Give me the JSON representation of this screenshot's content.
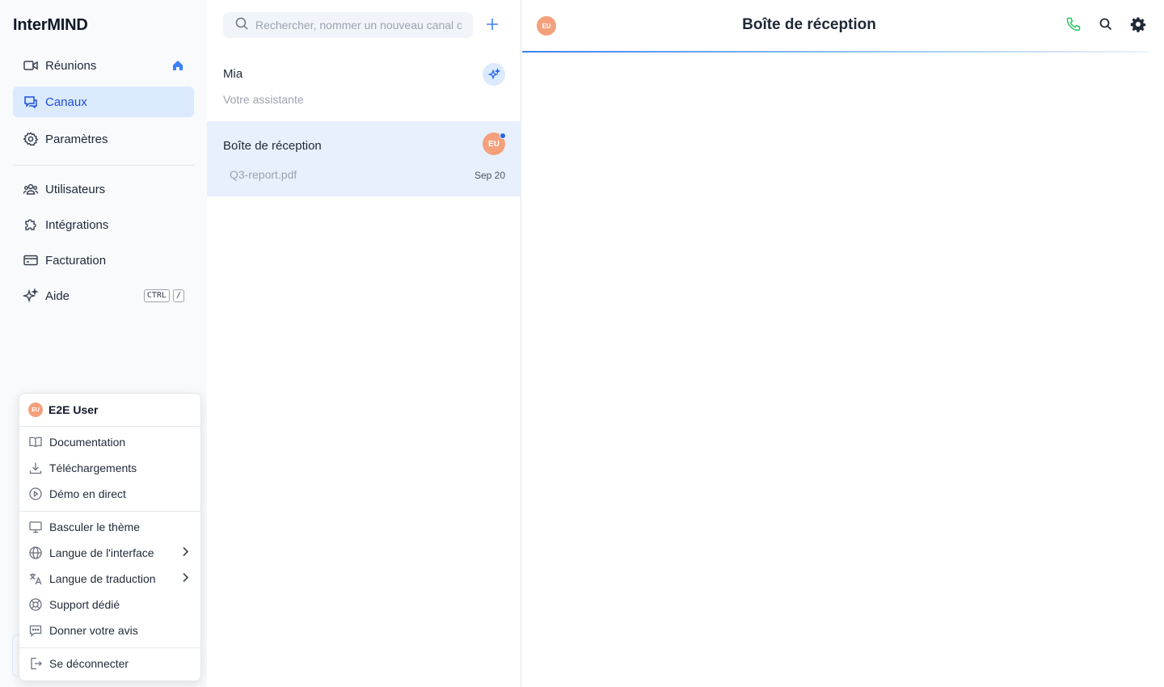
{
  "app": {
    "title": "InterMIND"
  },
  "sidebar": {
    "items": [
      {
        "label": "Réunions",
        "icon": "video-icon"
      },
      {
        "label": "Canaux",
        "icon": "chat-icon",
        "active": true
      },
      {
        "label": "Paramètres",
        "icon": "gear-icon"
      },
      {
        "label": "Utilisateurs",
        "icon": "users-icon"
      },
      {
        "label": "Intégrations",
        "icon": "puzzle-icon"
      },
      {
        "label": "Facturation",
        "icon": "credit-card-icon"
      },
      {
        "label": "Aide",
        "icon": "sparkles-icon",
        "shortcut": [
          "CTRL",
          "/"
        ]
      }
    ]
  },
  "user_menu": {
    "avatar": "EU",
    "name": "E2E User",
    "items": [
      {
        "label": "Documentation",
        "icon": "book-icon"
      },
      {
        "label": "Téléchargements",
        "icon": "download-icon"
      },
      {
        "label": "Démo en direct",
        "icon": "play-circle-icon"
      },
      {
        "label": "Basculer le thème",
        "icon": "monitor-icon"
      },
      {
        "label": "Langue de l'interface",
        "icon": "globe-icon",
        "submenu": true
      },
      {
        "label": "Langue de traduction",
        "icon": "translate-icon",
        "submenu": true
      },
      {
        "label": "Support dédié",
        "icon": "lifebuoy-icon"
      },
      {
        "label": "Donner votre avis",
        "icon": "feedback-icon"
      },
      {
        "label": "Se déconnecter",
        "icon": "logout-icon"
      }
    ]
  },
  "channels": {
    "search_placeholder": "Rechercher, nommer un nouveau canal ou",
    "list": [
      {
        "title": "Mia",
        "subtitle": "Votre assistante"
      },
      {
        "title": "Boîte de réception",
        "subtitle": "Q3-report.pdf",
        "date": "Sep 20",
        "avatar": "EU",
        "unread": true
      }
    ]
  },
  "main": {
    "title": "Boîte de réception",
    "avatar": "EU"
  },
  "colors": {
    "accent": "#2563eb",
    "active_bg": "#dbeafe",
    "avatar": "#f4a07b",
    "phone": "#22c55e"
  }
}
